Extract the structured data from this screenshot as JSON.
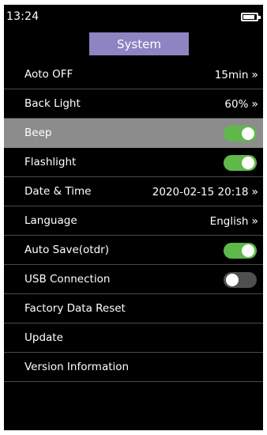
{
  "status_bar": {
    "time": "13:24",
    "battery_level": 0.85,
    "battery_icon": "battery-icon"
  },
  "title": "System",
  "colors": {
    "title_tab": "#8f84c2",
    "toggle_on": "#5fb84a",
    "toggle_off": "#4f4f4f",
    "selected_row": "#8c8c8c"
  },
  "settings": {
    "items": [
      {
        "label": "Aoto OFF",
        "value": "15min",
        "chevron": "»",
        "control": "value"
      },
      {
        "label": "Back Light",
        "value": "60%",
        "chevron": "»",
        "control": "value"
      },
      {
        "label": "Beep",
        "toggle": true,
        "control": "toggle",
        "selected": true
      },
      {
        "label": "Flashlight",
        "toggle": true,
        "control": "toggle"
      },
      {
        "label": "Date & Time",
        "value": "2020-02-15 20:18",
        "chevron": "»",
        "control": "value"
      },
      {
        "label": "Language",
        "value": "English",
        "chevron": "»",
        "control": "value"
      },
      {
        "label": "Auto Save(otdr)",
        "toggle": true,
        "control": "toggle"
      },
      {
        "label": "USB Connection",
        "toggle": false,
        "control": "toggle"
      },
      {
        "label": "Factory Data Reset",
        "control": "none"
      },
      {
        "label": "Update",
        "control": "none"
      },
      {
        "label": "Version Information",
        "control": "none"
      }
    ]
  }
}
